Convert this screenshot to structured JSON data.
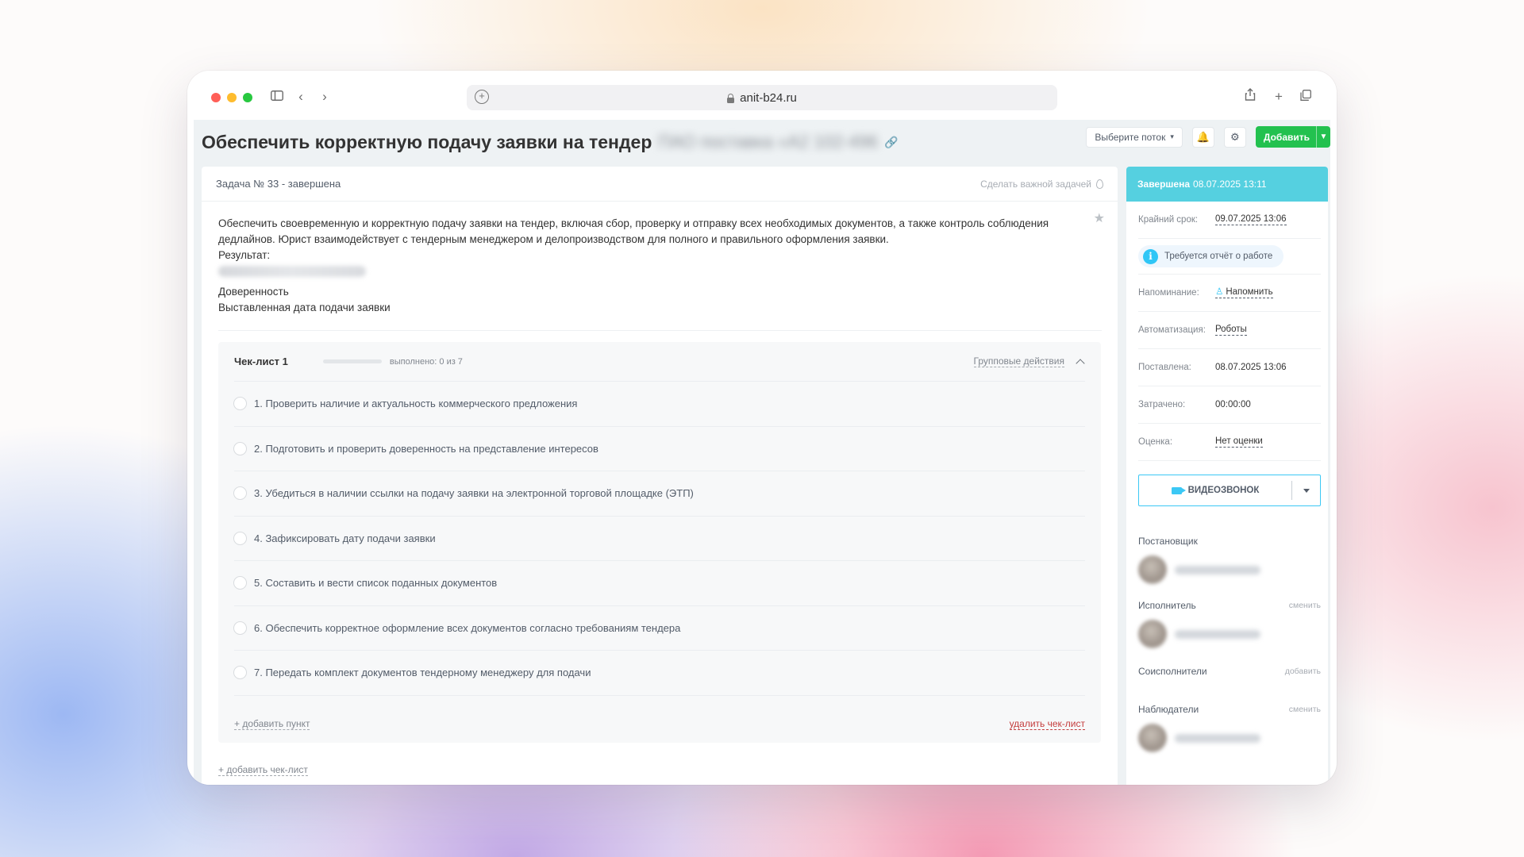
{
  "browser": {
    "url": "anit-b24.ru"
  },
  "header": {
    "title": "Обеспечить корректную подачу заявки на тендер",
    "title_suffix_blurred": "ПАО поставка «А2 102-496",
    "flow_select": "Выберите поток",
    "add_button": "Добавить"
  },
  "task": {
    "number_status": "Задача № 33 - завершена",
    "make_important": "Сделать важной задачей",
    "description": [
      "Обеспечить своевременную и корректную подачу заявки на тендер, включая сбор, проверку и отправку всех необходимых документов, а также контроль соблюдения дедлайнов. Юрист взаимодействует с тендерным менеджером и делопроизводством для полного и правильного оформления заявки.",
      "Результат:"
    ],
    "result_lines": [
      "Доверенность",
      "Выставленная дата подачи заявки"
    ]
  },
  "checklist": {
    "title": "Чек-лист 1",
    "progress": 0,
    "status": "выполнено: 0 из 7",
    "group_actions": "Групповые действия",
    "items": [
      "1. Проверить наличие и актуальность коммерческого предложения",
      "2. Подготовить и проверить доверенность на представление интересов",
      "3. Убедиться в наличии ссылки на подачу заявки на электронной торговой площадке (ЭТП)",
      "4. Зафиксировать дату подачи заявки",
      "5. Составить и вести список поданных документов",
      "6. Обеспечить корректное оформление всех документов согласно требованиям тендера",
      "7. Передать комплект документов тендерному менеджеру для подачи"
    ],
    "add_item": "+ добавить пункт",
    "delete": "удалить чек-лист",
    "add_checklist": "+ добавить чек-лист"
  },
  "sidebar": {
    "status_label": "Завершена",
    "status_date": "08.07.2025 13:11",
    "status_color": "#55d0e0",
    "deadline_label": "Крайний срок:",
    "deadline_value": "09.07.2025 13:06",
    "report_required": "Требуется отчёт о работе",
    "reminder_label": "Напоминание:",
    "reminder_value": "Напомнить",
    "automation_label": "Автоматизация:",
    "automation_value": "Роботы",
    "created_label": "Поставлена:",
    "created_value": "08.07.2025 13:06",
    "spent_label": "Затрачено:",
    "spent_value": "00:00:00",
    "rating_label": "Оценка:",
    "rating_value": "Нет оценки",
    "video_call": "ВИДЕОЗВОНОК",
    "creator_label": "Постановщик",
    "assignee_label": "Исполнитель",
    "assignee_action": "сменить",
    "coexec_label": "Соисполнители",
    "coexec_action": "добавить",
    "observers_label": "Наблюдатели",
    "observers_action": "сменить"
  },
  "colors": {
    "accent_green": "#23c14f",
    "accent_blue": "#2fc6f6",
    "danger": "#c43d3d"
  }
}
